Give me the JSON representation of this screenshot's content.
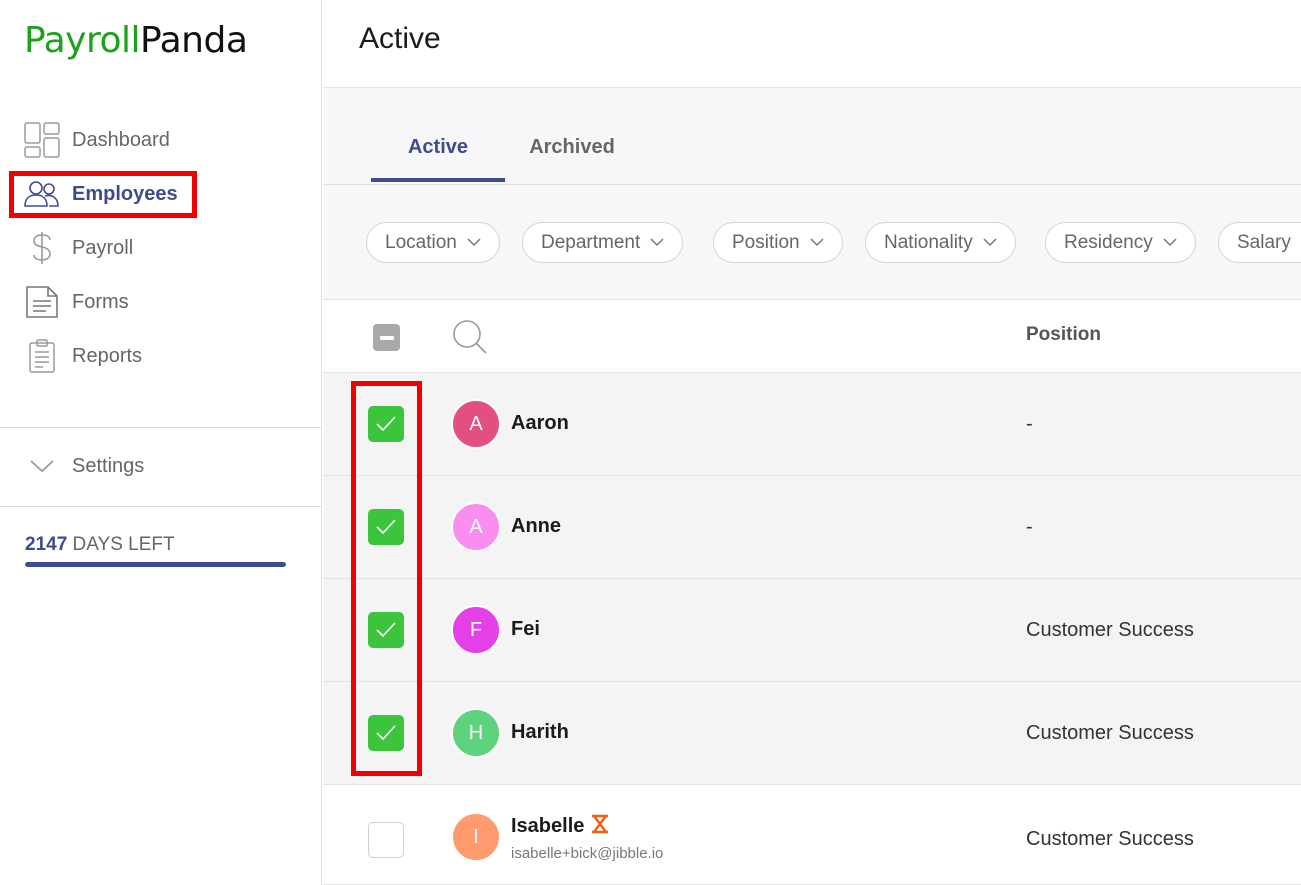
{
  "app": {
    "logo_part1": "Payroll",
    "logo_part2": "Panda",
    "brand_color": "#1aa31a",
    "accent_color": "#3d4c8f",
    "highlight_color": "#f20000"
  },
  "sidebar": {
    "items": [
      {
        "label": "Dashboard",
        "icon": "dashboard-icon"
      },
      {
        "label": "Employees",
        "icon": "employees-icon",
        "active": true
      },
      {
        "label": "Payroll",
        "icon": "dollar-icon"
      },
      {
        "label": "Forms",
        "icon": "forms-icon"
      },
      {
        "label": "Reports",
        "icon": "clipboard-icon"
      }
    ],
    "settings_label": "Settings",
    "days_left_number": "2147",
    "days_left_text": " DAYS LEFT",
    "days_left_fill": 1.0
  },
  "header": {
    "title": "Active"
  },
  "tabs": [
    {
      "label": "Active",
      "active": true
    },
    {
      "label": "Archived",
      "active": false
    }
  ],
  "filters": [
    "Location",
    "Department",
    "Position",
    "Nationality",
    "Residency",
    "Salary"
  ],
  "table": {
    "position_header": "Position",
    "rows": [
      {
        "initial": "A",
        "name": "Aaron",
        "email": "",
        "position": "-",
        "checked": true,
        "avatar_color": "#e3507f"
      },
      {
        "initial": "A",
        "name": "Anne",
        "email": "",
        "position": "-",
        "checked": true,
        "avatar_color": "#f98df0"
      },
      {
        "initial": "F",
        "name": "Fei",
        "email": "",
        "position": "Customer Success",
        "checked": true,
        "avatar_color": "#e53fe8"
      },
      {
        "initial": "H",
        "name": "Harith",
        "email": "",
        "position": "Customer Success",
        "checked": true,
        "avatar_color": "#5fd27d"
      },
      {
        "initial": "I",
        "name": "Isabelle",
        "email": "isabelle+bick@jibble.io",
        "position": "Customer Success",
        "checked": false,
        "avatar_color": "#ff9a6e",
        "status_icon": "hourglass-icon"
      }
    ]
  }
}
